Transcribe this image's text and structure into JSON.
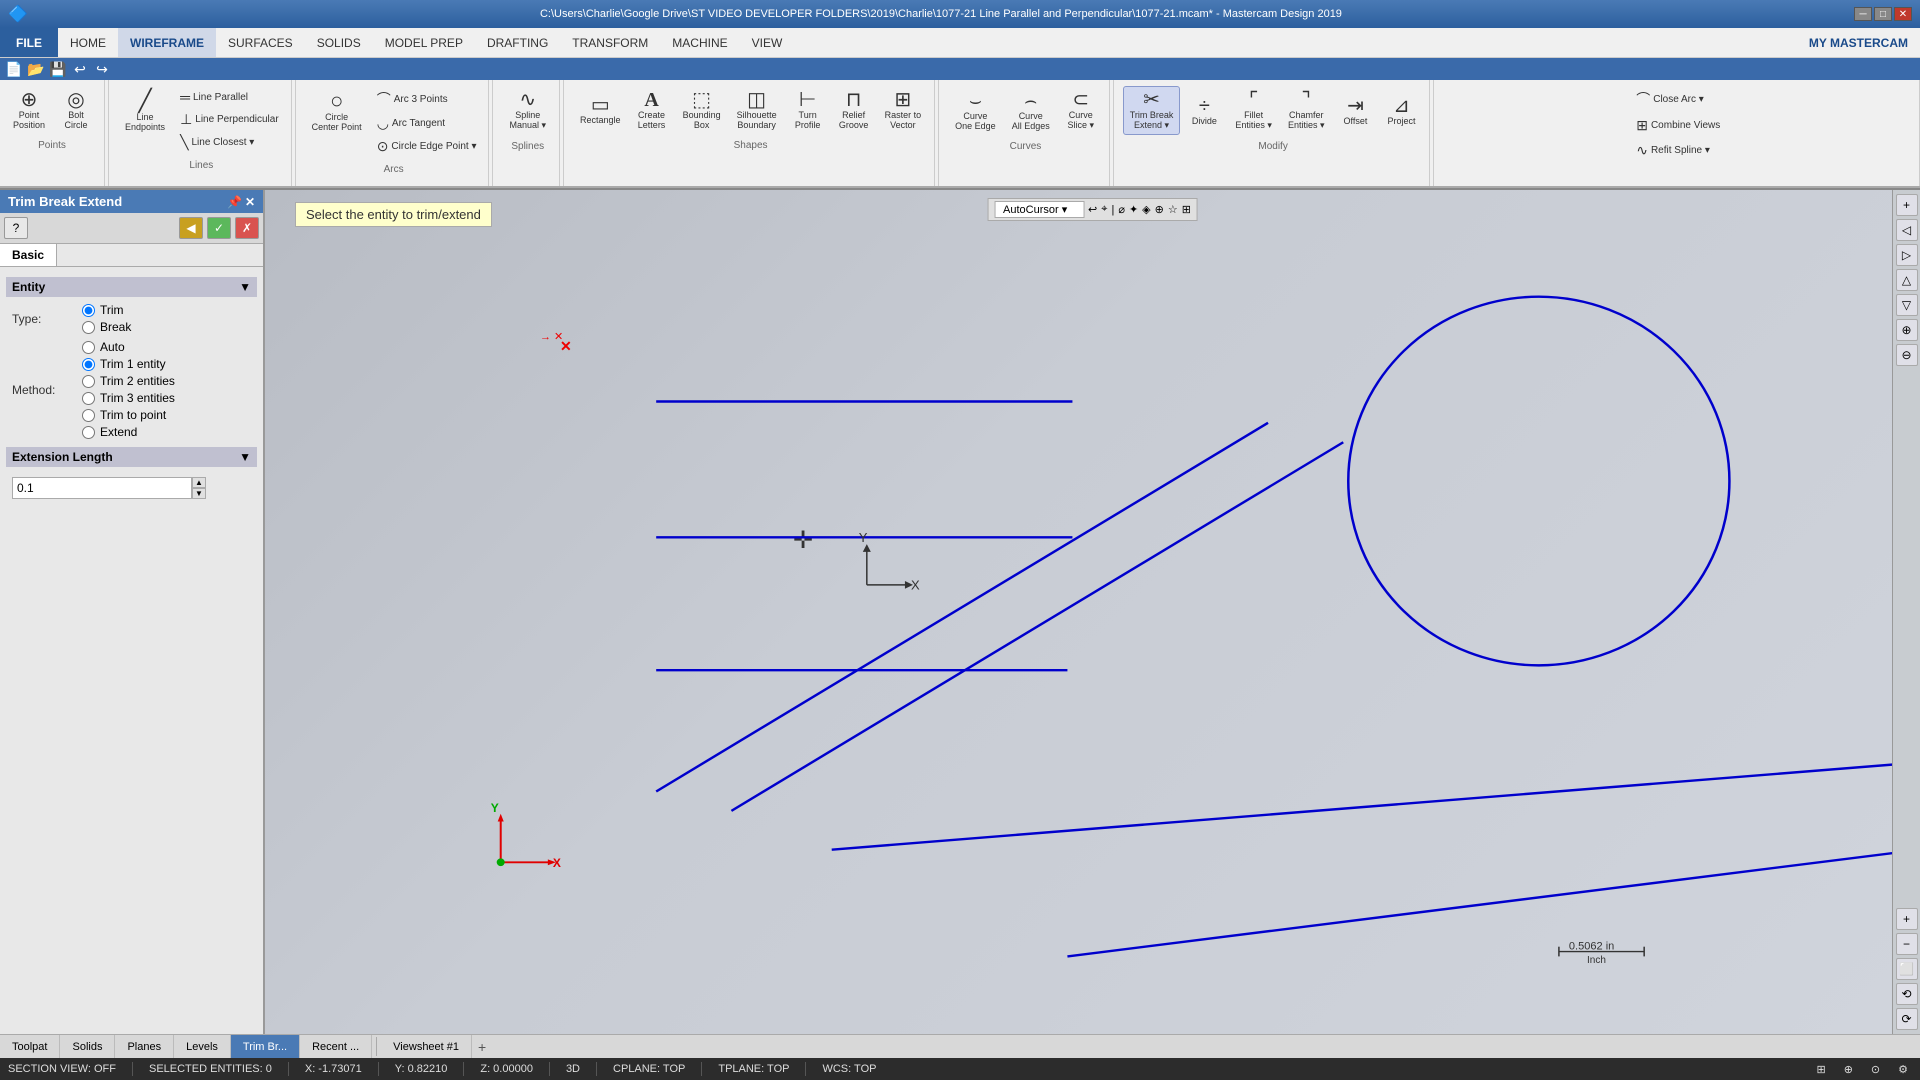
{
  "titlebar": {
    "title": "C:\\Users\\Charlie\\Google Drive\\ST VIDEO DEVELOPER FOLDERS\\2019\\Charlie\\1077-21 Line Parallel and Perpendicular\\1077-21.mcam* - Mastercam Design 2019"
  },
  "menubar": {
    "items": [
      "FILE",
      "HOME",
      "WIREFRAME",
      "SURFACES",
      "SOLIDS",
      "MODEL PREP",
      "DRAFTING",
      "TRANSFORM",
      "MACHINE",
      "VIEW"
    ],
    "active": "WIREFRAME",
    "right_label": "MY MASTERCAM"
  },
  "ribbon": {
    "sections": [
      {
        "label": "Points",
        "tools": [
          {
            "id": "point-position",
            "label": "Point\nPosition",
            "icon": "⊕"
          },
          {
            "id": "bolt-circle",
            "label": "Bolt\nCircle",
            "icon": "◎"
          }
        ]
      },
      {
        "label": "Lines",
        "tools": [
          {
            "id": "line-endpoints",
            "label": "Line\nEndpoints",
            "icon": "╱"
          },
          {
            "id": "line-parallel",
            "label": "Line Parallel",
            "icon": "═"
          },
          {
            "id": "line-perpendicular",
            "label": "Line Perpendicular",
            "icon": "⊥"
          },
          {
            "id": "line-closest",
            "label": "Line Closest ▾",
            "icon": "╲"
          }
        ]
      },
      {
        "label": "Arcs",
        "tools": [
          {
            "id": "circle-center-point",
            "label": "Circle\nCenter Point",
            "icon": "○"
          },
          {
            "id": "arc-3-points",
            "label": "Arc 3 Points",
            "icon": "⌒"
          },
          {
            "id": "arc-tangent",
            "label": "Arc Tangent",
            "icon": "◡"
          },
          {
            "id": "circle-edge-point",
            "label": "Circle Edge Point ▾",
            "icon": "⊙"
          }
        ]
      },
      {
        "label": "Splines",
        "tools": [
          {
            "id": "spline-manual",
            "label": "Spline\nManual ▾",
            "icon": "∿"
          }
        ]
      },
      {
        "label": "Shapes",
        "tools": [
          {
            "id": "rectangle",
            "label": "Rectangle",
            "icon": "▭"
          },
          {
            "id": "create-letters",
            "label": "Create\nLetters",
            "icon": "A"
          },
          {
            "id": "bounding-box",
            "label": "Bounding\nBox",
            "icon": "⬚"
          },
          {
            "id": "silhouette-boundary",
            "label": "Silhouette\nBoundary",
            "icon": "◫"
          },
          {
            "id": "turn-profile",
            "label": "Turn\nProfile",
            "icon": "⊢"
          },
          {
            "id": "relief-groove",
            "label": "Relief\nGroove",
            "icon": "⊓"
          },
          {
            "id": "raster-to-vector",
            "label": "Raster to\nVector",
            "icon": "⊞"
          }
        ]
      },
      {
        "label": "Curves",
        "tools": [
          {
            "id": "curve-one-edge",
            "label": "Curve\nOne Edge",
            "icon": "⌣"
          },
          {
            "id": "curve-all-edges",
            "label": "Curve\nAll Edges",
            "icon": "⌢"
          },
          {
            "id": "curve-slice",
            "label": "Curve\nSlice ▾",
            "icon": "⊂"
          }
        ]
      },
      {
        "label": "Modify",
        "tools": [
          {
            "id": "trim-break-extend",
            "label": "Trim Break\nExtend ▾",
            "icon": "✂"
          },
          {
            "id": "divide",
            "label": "Divide",
            "icon": "÷"
          },
          {
            "id": "fillet-entities",
            "label": "Fillet\nEntities ▾",
            "icon": "⌜"
          },
          {
            "id": "chamfer-entities",
            "label": "Chamfer\nEntities ▾",
            "icon": "⌝"
          },
          {
            "id": "offset",
            "label": "Offset",
            "icon": "⇥"
          },
          {
            "id": "project",
            "label": "Project",
            "icon": "⊿"
          }
        ]
      },
      {
        "label": "",
        "tools": [
          {
            "id": "close-arc",
            "label": "Close Arc ▾",
            "icon": "⌒"
          },
          {
            "id": "combine-views",
            "label": "Combine Views",
            "icon": "⊞"
          },
          {
            "id": "refit-spline",
            "label": "Refit Spline ▾",
            "icon": "∿"
          }
        ]
      }
    ]
  },
  "panel": {
    "title": "Trim Break Extend",
    "tabs": [
      "Basic"
    ],
    "active_tab": "Basic",
    "hint": "Select the entity to trim/extend",
    "entity_section": {
      "label": "Entity",
      "type_label": "Type:",
      "type_options": [
        "Trim",
        "Break"
      ],
      "type_selected": "Trim",
      "method_label": "Method:",
      "method_options": [
        "Auto",
        "Trim 1 entity",
        "Trim 2 entities",
        "Trim 3 entities",
        "Trim to point",
        "Extend"
      ],
      "method_selected": "Trim 1 entity"
    },
    "extension_section": {
      "label": "Extension Length",
      "value": "0.1"
    }
  },
  "bottom_tabs": {
    "items": [
      "Toolpat",
      "Solids",
      "Planes",
      "Levels",
      "Trim Br...",
      "Recent ..."
    ],
    "active": "Trim Br...",
    "viewsheet": "Viewsheet #1"
  },
  "statusbar": {
    "section_view": "SECTION VIEW: OFF",
    "selected": "SELECTED ENTITIES: 0",
    "x": "X:  -1.73071",
    "y": "Y:  0.82210",
    "z": "Z:  0.00000",
    "mode": "3D",
    "cplane": "CPLANE: TOP",
    "tplane": "TPLANE: TOP",
    "wcs": "WCS: TOP",
    "scale_label": "0.5062 in\nInch"
  },
  "icons": {
    "help": "?",
    "back": "◀",
    "ok": "✓",
    "cancel": "✗",
    "collapse": "▼",
    "expand": "▶",
    "spin_up": "▲",
    "spin_down": "▼",
    "add": "+"
  }
}
